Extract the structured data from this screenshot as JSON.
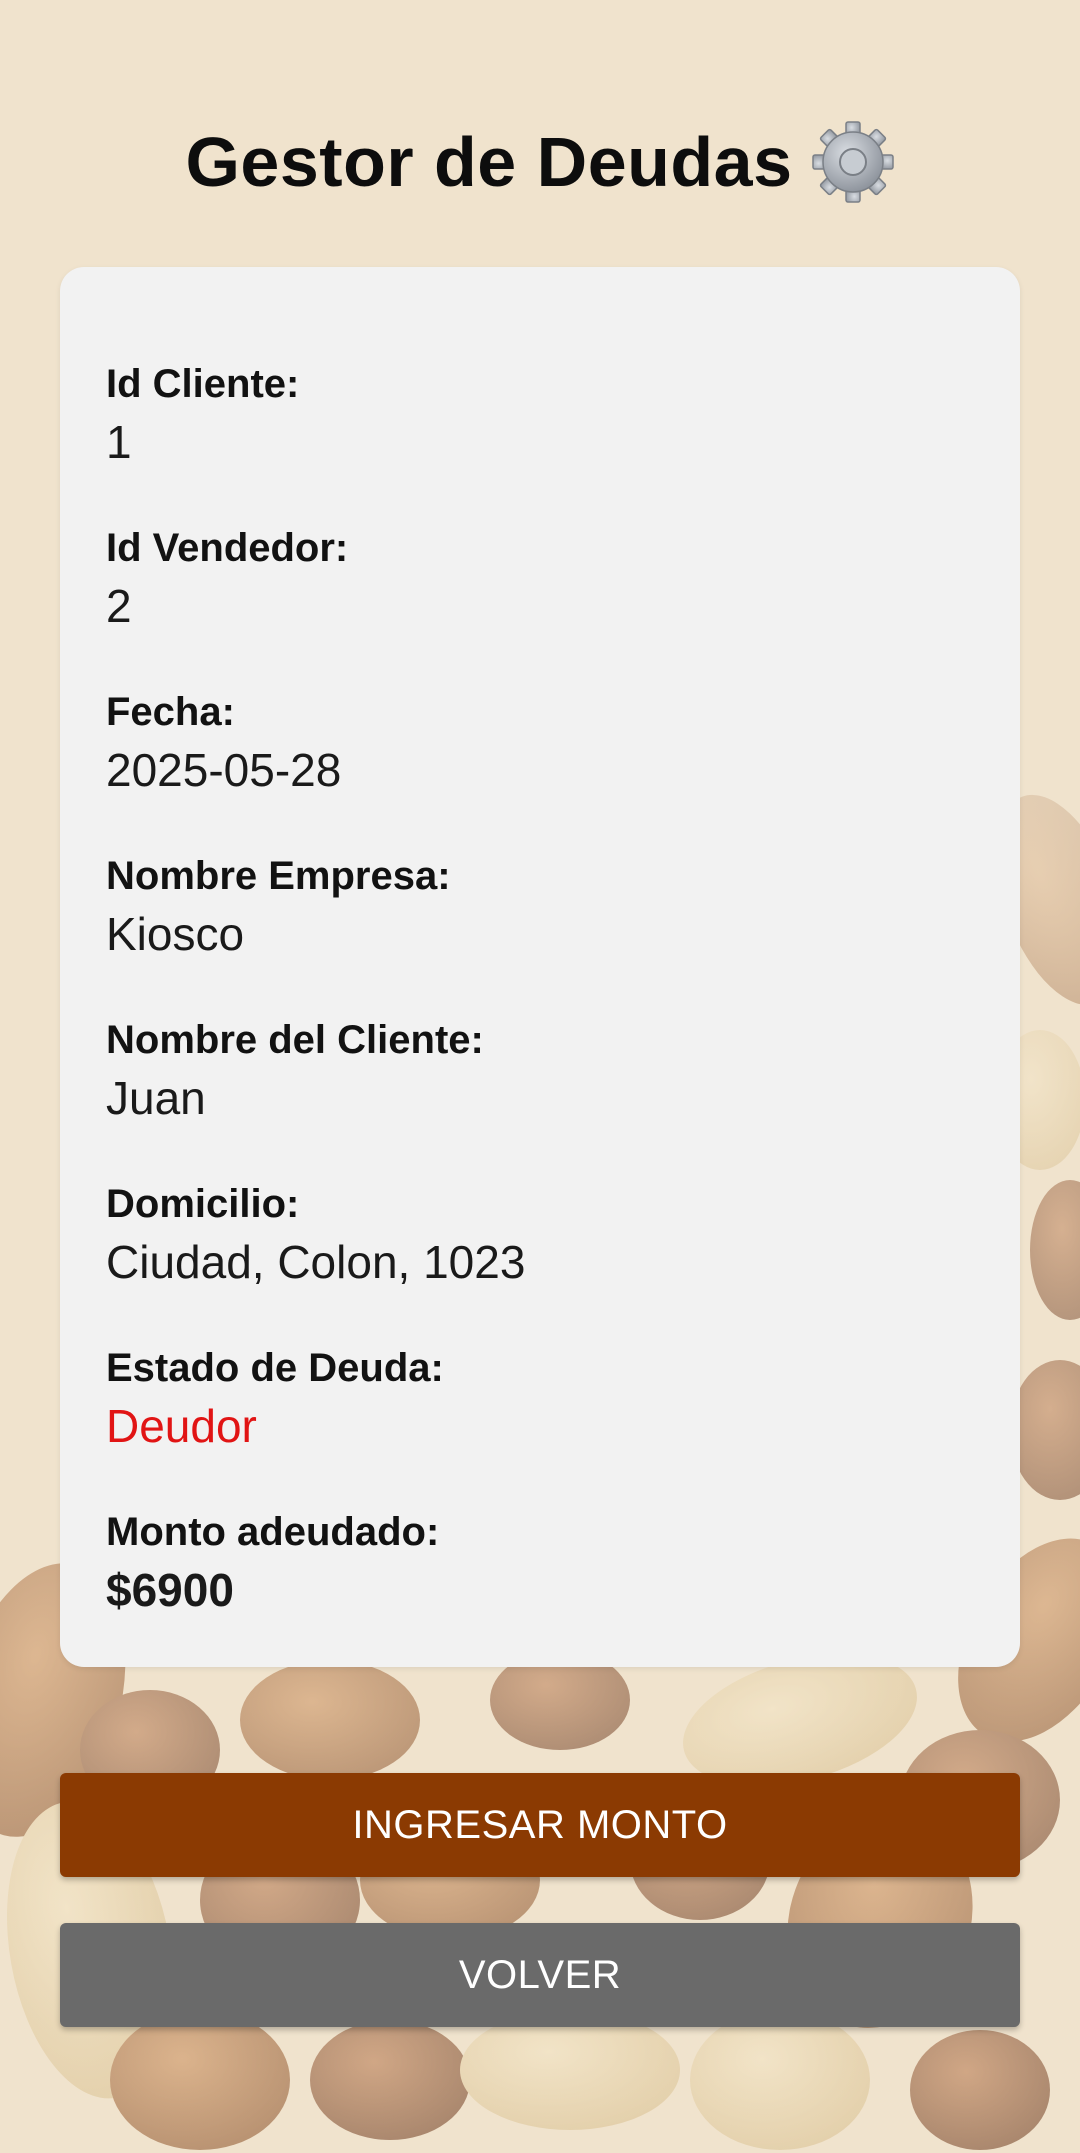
{
  "header": {
    "title": "Gestor de Deudas",
    "icon": "gear-icon"
  },
  "details": [
    {
      "label": "Id Cliente:",
      "value": "1"
    },
    {
      "label": "Id Vendedor:",
      "value": "2"
    },
    {
      "label": "Fecha:",
      "value": "2025-05-28"
    },
    {
      "label": "Nombre Empresa:",
      "value": "Kiosco"
    },
    {
      "label": "Nombre del Cliente:",
      "value": "Juan"
    },
    {
      "label": "Domicilio:",
      "value": "Ciudad, Colon, 1023"
    },
    {
      "label": "Estado de Deuda:",
      "value": "Deudor"
    },
    {
      "label": "Monto adeudado:",
      "value": "$6900"
    }
  ],
  "actions": {
    "primary_label": "INGRESAR MONTO",
    "secondary_label": "VOLVER"
  },
  "colors": {
    "background": "#f0e3cd",
    "card": "#f2f2f2",
    "primary_button": "#8b3a02",
    "secondary_button": "#6a6a6a",
    "debt_status": "#e11414"
  },
  "background_image": "nuts-pattern"
}
